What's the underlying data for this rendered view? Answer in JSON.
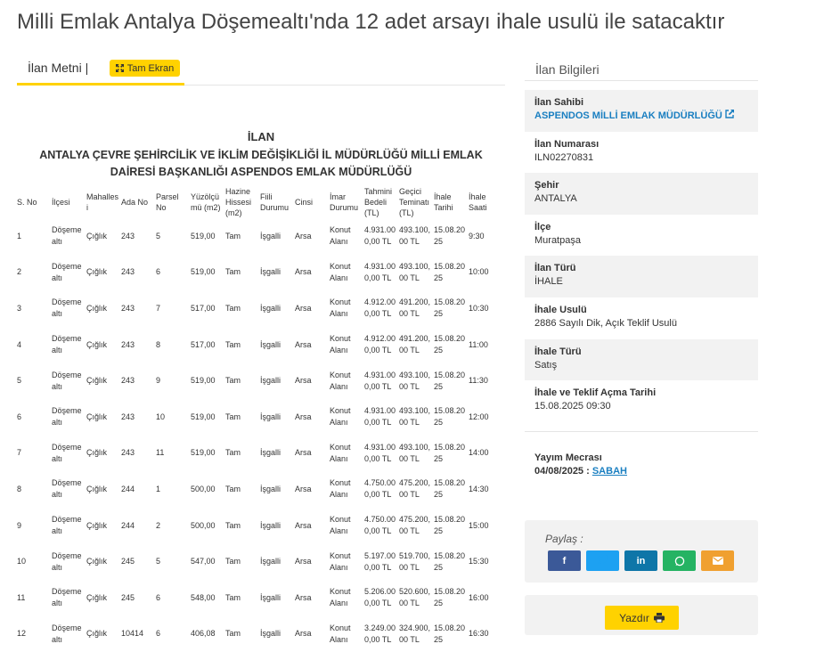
{
  "title": "Milli Emlak Antalya Döşemealtı'nda 12 adet arsayı ihale usulü ile satacaktır",
  "tabs": {
    "ilan_metni": "İlan Metni |",
    "tam_ekran": "Tam Ekran"
  },
  "document": {
    "heading": "İLAN",
    "subheading": "ANTALYA ÇEVRE ŞEHİRCİLİK VE İKLİM DEĞİŞİKLİĞİ İL MÜDÜRLÜĞÜ MİLLİ EMLAK DAİRESİ BAŞKANLIĞI ASPENDOS EMLAK MÜDÜRLÜĞÜ",
    "columns": [
      "S. No",
      "İlçesi",
      "Mahalles i",
      "Ada No",
      "Parsel No",
      "Yüzölçü mü (m2)",
      "Hazine Hissesi (m2)",
      "Fiili Durumu",
      "Cinsi",
      "İmar Durumu",
      "Tahmini Bedeli (TL)",
      "Geçici Teminatı (TL)",
      "İhale Tarihi",
      "İhale Saati"
    ],
    "rows": [
      [
        "1",
        "Döşeme altı",
        "Çığlık",
        "243",
        "5",
        "519,00",
        "Tam",
        "İşgalli",
        "Arsa",
        "Konut Alanı",
        "4.931.00 0,00 TL",
        "493.100, 00 TL",
        "15.08.20 25",
        "9:30"
      ],
      [
        "2",
        "Döşeme altı",
        "Çığlık",
        "243",
        "6",
        "519,00",
        "Tam",
        "İşgalli",
        "Arsa",
        "Konut Alanı",
        "4.931.00 0,00 TL",
        "493.100, 00 TL",
        "15.08.20 25",
        "10:00"
      ],
      [
        "3",
        "Döşeme altı",
        "Çığlık",
        "243",
        "7",
        "517,00",
        "Tam",
        "İşgalli",
        "Arsa",
        "Konut Alanı",
        "4.912.00 0,00 TL",
        "491.200, 00 TL",
        "15.08.20 25",
        "10:30"
      ],
      [
        "4",
        "Döşeme altı",
        "Çığlık",
        "243",
        "8",
        "517,00",
        "Tam",
        "İşgalli",
        "Arsa",
        "Konut Alanı",
        "4.912.00 0,00 TL",
        "491.200, 00 TL",
        "15.08.20 25",
        "11:00"
      ],
      [
        "5",
        "Döşeme altı",
        "Çığlık",
        "243",
        "9",
        "519,00",
        "Tam",
        "İşgalli",
        "Arsa",
        "Konut Alanı",
        "4.931.00 0,00 TL",
        "493.100, 00 TL",
        "15.08.20 25",
        "11:30"
      ],
      [
        "6",
        "Döşeme altı",
        "Çığlık",
        "243",
        "10",
        "519,00",
        "Tam",
        "İşgalli",
        "Arsa",
        "Konut Alanı",
        "4.931.00 0,00 TL",
        "493.100, 00 TL",
        "15.08.20 25",
        "12:00"
      ],
      [
        "7",
        "Döşeme altı",
        "Çığlık",
        "243",
        "11",
        "519,00",
        "Tam",
        "İşgalli",
        "Arsa",
        "Konut Alanı",
        "4.931.00 0,00 TL",
        "493.100, 00 TL",
        "15.08.20 25",
        "14:00"
      ],
      [
        "8",
        "Döşeme altı",
        "Çığlık",
        "244",
        "1",
        "500,00",
        "Tam",
        "İşgalli",
        "Arsa",
        "Konut Alanı",
        "4.750.00 0,00 TL",
        "475.200, 00 TL",
        "15.08.20 25",
        "14:30"
      ],
      [
        "9",
        "Döşeme altı",
        "Çığlık",
        "244",
        "2",
        "500,00",
        "Tam",
        "İşgalli",
        "Arsa",
        "Konut Alanı",
        "4.750.00 0,00 TL",
        "475.200, 00 TL",
        "15.08.20 25",
        "15:00"
      ],
      [
        "10",
        "Döşeme altı",
        "Çığlık",
        "245",
        "5",
        "547,00",
        "Tam",
        "İşgalli",
        "Arsa",
        "Konut Alanı",
        "5.197.00 0,00 TL",
        "519.700, 00 TL",
        "15.08.20 25",
        "15:30"
      ],
      [
        "11",
        "Döşeme altı",
        "Çığlık",
        "245",
        "6",
        "548,00",
        "Tam",
        "İşgalli",
        "Arsa",
        "Konut Alanı",
        "5.206.00 0,00 TL",
        "520.600, 00 TL",
        "15.08.20 25",
        "16:00"
      ],
      [
        "12",
        "Döşeme altı",
        "Çığlık",
        "10414",
        "6",
        "406,08",
        "Tam",
        "İşgalli",
        "Arsa",
        "Konut Alanı",
        "3.249.00 0,00 TL",
        "324.900, 00 TL",
        "15.08.20 25",
        "16:30"
      ]
    ]
  },
  "sidebar": {
    "tab": "İlan Bilgileri",
    "items": [
      {
        "label": "İlan Sahibi",
        "value": "ASPENDOS MİLLİ EMLAK MÜDÜRLÜĞÜ"
      },
      {
        "label": "İlan Numarası",
        "value": "ILN02270831"
      },
      {
        "label": "Şehir",
        "value": "ANTALYA"
      },
      {
        "label": "İlçe",
        "value": "Muratpaşa"
      },
      {
        "label": "İlan Türü",
        "value": "İHALE"
      },
      {
        "label": "İhale Usulü",
        "value": "2886 Sayılı Dik, Açık Teklif Usulü"
      },
      {
        "label": "İhale Türü",
        "value": "Satış"
      },
      {
        "label": "İhale ve Teklif Açma Tarihi",
        "value": "15.08.2025 09:30"
      }
    ],
    "yayim": {
      "label": "Yayım Mecrası",
      "date": "04/08/2025 :",
      "source": "SABAH"
    },
    "share": {
      "label": "Paylaş :"
    },
    "print_label": "Yazdır"
  },
  "colors": {
    "accent": "#ffd200",
    "link": "#1a7fc1",
    "facebook": "#3b5998",
    "twitter": "#1da1f2",
    "linkedin": "#0e76a8",
    "whatsapp": "#25b363",
    "email": "#f0a030"
  },
  "icons": [
    "expand-icon",
    "external-link-icon",
    "facebook-icon",
    "twitter-icon",
    "linkedin-icon",
    "whatsapp-icon",
    "email-icon",
    "print-icon"
  ]
}
